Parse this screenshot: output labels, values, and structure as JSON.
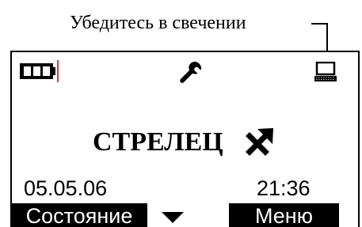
{
  "callout": {
    "text": "Убедитесь в свечении"
  },
  "status_bar": {
    "battery_icon": "battery-icon",
    "settings_icon": "wrench-icon",
    "connection_icon": "computer-icon"
  },
  "main": {
    "title": "СТРЕЛЕЦ",
    "title_icon": "sagittarius-arrow-icon",
    "date": "05.05.06",
    "time": "21:36"
  },
  "softkeys": {
    "left_label": "Состояние",
    "right_label": "Меню",
    "nav_icon": "down-triangle-icon"
  },
  "colors": {
    "background": "#ffffff",
    "foreground": "#000000",
    "battery_marker": "#d33b3b"
  }
}
